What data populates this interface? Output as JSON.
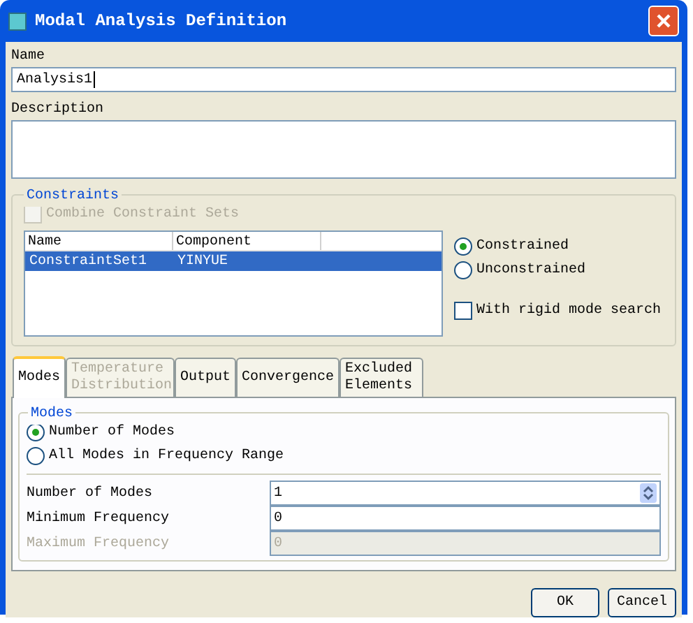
{
  "window": {
    "title": "Modal Analysis Definition"
  },
  "name": {
    "label": "Name",
    "value": "Analysis1"
  },
  "description": {
    "label": "Description"
  },
  "constraints": {
    "title": "Constraints",
    "combine": {
      "label": "Combine Constraint Sets",
      "checked": false,
      "disabled": true
    },
    "table": {
      "columns": [
        "Name",
        "Component"
      ],
      "rows": [
        {
          "cells": [
            "ConstraintSet1",
            "YINYUE"
          ],
          "selected": true
        }
      ]
    },
    "options": [
      {
        "label": "Constrained",
        "selected": true
      },
      {
        "label": "Unconstrained",
        "selected": false
      }
    ],
    "rigid": {
      "label": "With rigid mode search",
      "checked": false
    }
  },
  "tabs": [
    {
      "label": "Modes",
      "selected": true,
      "disabled": false
    },
    {
      "label": "Temperature Distribution",
      "selected": false,
      "disabled": true
    },
    {
      "label": "Output",
      "selected": false,
      "disabled": false
    },
    {
      "label": "Convergence",
      "selected": false,
      "disabled": false
    },
    {
      "label": "Excluded Elements",
      "selected": false,
      "disabled": false
    }
  ],
  "modes": {
    "title": "Modes",
    "options": [
      {
        "label": "Number of Modes",
        "selected": true
      },
      {
        "label": "All Modes in Frequency Range",
        "selected": false
      }
    ],
    "fields": [
      {
        "label": "Number of Modes",
        "value": "1",
        "kind": "spinner",
        "disabled": false
      },
      {
        "label": "Minimum Frequency",
        "value": "0",
        "kind": "text",
        "disabled": false
      },
      {
        "label": "Maximum Frequency",
        "value": "0",
        "kind": "text",
        "disabled": true
      }
    ]
  },
  "buttons": [
    "OK",
    "Cancel"
  ]
}
